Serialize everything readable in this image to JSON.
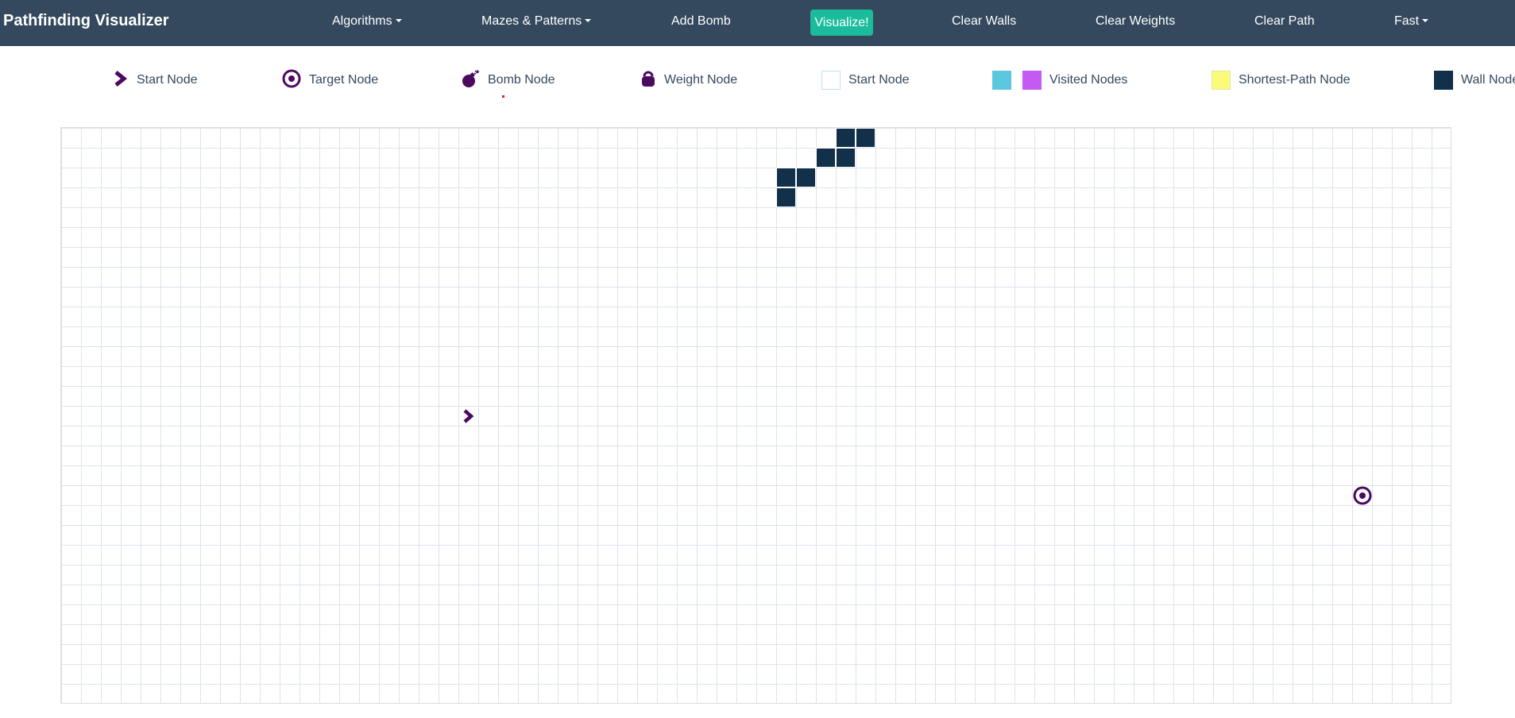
{
  "navbar": {
    "brand": "Pathfinding Visualizer",
    "algorithms_label": "Algorithms",
    "mazes_label": "Mazes & Patterns",
    "add_bomb_label": "Add Bomb",
    "visualize_label": "Visualize!",
    "clear_walls_label": "Clear Walls",
    "clear_weights_label": "Clear Weights",
    "clear_path_label": "Clear Path",
    "speed_label": "Fast"
  },
  "legend": {
    "start": "Start Node",
    "target": "Target Node",
    "bomb": "Bomb Node",
    "weight": "Weight Node",
    "unvisited": "Start Node",
    "visited": "Visited Nodes",
    "shortest_path": "Shortest-Path Node",
    "wall": "Wall Node"
  },
  "colors": {
    "navbar_bg": "#34495e",
    "visualize_bg": "#1abc9c",
    "node_icon": "#4b0a5f",
    "visited_blue": "#5bc8e0",
    "visited_purple": "#c35af2",
    "shortest_path_yellow": "#fbfb7a",
    "wall": "#12304a",
    "grid_line": "#dde3ea"
  },
  "icons": {
    "start": "chevron-right-icon",
    "target": "target-icon",
    "bomb": "bomb-icon",
    "weight": "weight-icon"
  }
}
